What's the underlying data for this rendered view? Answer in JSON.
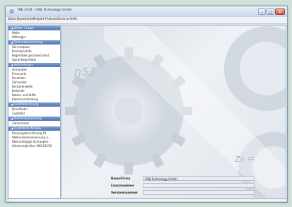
{
  "window": {
    "title": "TBK 2014 - GWJ Technology GmbH",
    "controls": {
      "minimize": "–",
      "maximize": "□",
      "close": "✕"
    }
  },
  "menu": [
    "Datei",
    "Bearbeiten",
    "Projekt",
    "Protokoll",
    "Extras",
    "Hilfe"
  ],
  "sidebar": {
    "sections": [
      {
        "title": "Wellen / Lager",
        "items": [
          "Welle",
          "Wälzlager"
        ]
      },
      {
        "title": "Zahnradberechnung",
        "items": [
          "Stirnradpaar",
          "Planetenstufe",
          "Kegelräder geradverzahnt",
          "Spiral-Kegelräder"
        ]
      },
      {
        "title": "Verbindungen",
        "items": [
          "Schrauben",
          "Pressverb.",
          "Passfeder",
          "Zahnwelle",
          "Kerbzahnwelle",
          "Keilwelle",
          "Bolzen und Stifte",
          "Klemmverbindung"
        ]
      },
      {
        "title": "Federberechnung",
        "items": [
          "Druckfeder",
          "Zugfeder"
        ]
      },
      {
        "title": "Riemenberechnung",
        "items": [
          "Zahnriemen"
        ]
      },
      {
        "title": "Zusätzliche Module",
        "items": [
          "Passungsberechnung DI...",
          "Wellendimensionierung a...",
          "Überschlägige Schrauben...",
          "Härtevergleicher DIN 50150"
        ]
      }
    ]
  },
  "info": {
    "company_label": "Name/Firma",
    "company_value": "GWJ Technology GmbH",
    "license_label": "Lizenznummer",
    "license_value": "",
    "version_label": "Versionsnummer",
    "version_value": ""
  },
  "background": {
    "watermark_left": "ŋ53",
    "watermark_right": "z₈ ="
  },
  "colors": {
    "section_header": "#5a7fbd",
    "window_bg": "#cfe1d9",
    "close_button": "#cf4b35"
  }
}
